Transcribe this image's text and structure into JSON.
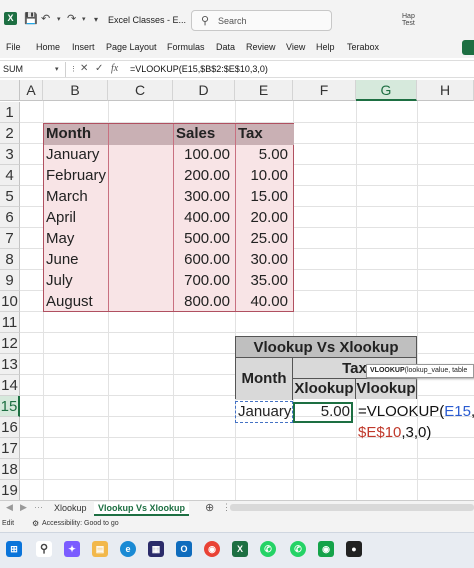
{
  "app": {
    "logo": "X",
    "title": "Excel Classes  -  E...",
    "search_placeholder": "Search",
    "top_right": "Hap\nTest"
  },
  "menu": [
    "File",
    "Home",
    "Insert",
    "Page Layout",
    "Formulas",
    "Data",
    "Review",
    "View",
    "Help",
    "Terabox"
  ],
  "formula_bar": {
    "name_box": "SUM",
    "fx": "fx",
    "formula": "=VLOOKUP(E15,$B$2:$E$10,3,0)"
  },
  "columns": [
    "A",
    "B",
    "C",
    "D",
    "E",
    "F",
    "G",
    "H"
  ],
  "rows": [
    "1",
    "2",
    "3",
    "4",
    "5",
    "6",
    "7",
    "8",
    "9",
    "10",
    "11",
    "12",
    "13",
    "14",
    "15",
    "16",
    "17",
    "18",
    "19"
  ],
  "table": {
    "headers": [
      "Month",
      "Sales",
      "Tax"
    ],
    "rows": [
      [
        "January",
        "100.00",
        "5.00"
      ],
      [
        "February",
        "200.00",
        "10.00"
      ],
      [
        "March",
        "300.00",
        "15.00"
      ],
      [
        "April",
        "400.00",
        "20.00"
      ],
      [
        "May",
        "500.00",
        "25.00"
      ],
      [
        "June",
        "600.00",
        "30.00"
      ],
      [
        "July",
        "700.00",
        "35.00"
      ],
      [
        "August",
        "800.00",
        "40.00"
      ]
    ]
  },
  "comparison": {
    "title": "Vlookup Vs Xlookup",
    "month_label": "Month",
    "tax_label": "Tax",
    "xlookup_label": "Xlookup",
    "vlookup_label": "Vlookup",
    "month_value": "January",
    "xlookup_value": "5.00",
    "formula_line1_prefix": "=VLOOKUP(",
    "formula_line1_ref": "E15",
    "formula_line1_suffix": ",$",
    "formula_line2_ref": "$E$10",
    "formula_line2_suffix": ",3,0)"
  },
  "tooltip": {
    "fn": "VLOOKUP",
    "args": "(lookup_value, table"
  },
  "sheet_tabs": [
    "Xlookup",
    "Vlookup Vs Xlookup"
  ],
  "status": {
    "mode": "Edit",
    "accessibility": "Accessibility: Good to go"
  },
  "colors": {
    "excel_green": "#1d6f42",
    "table_fill": "#f8e4e6",
    "table_border": "#b05060"
  }
}
